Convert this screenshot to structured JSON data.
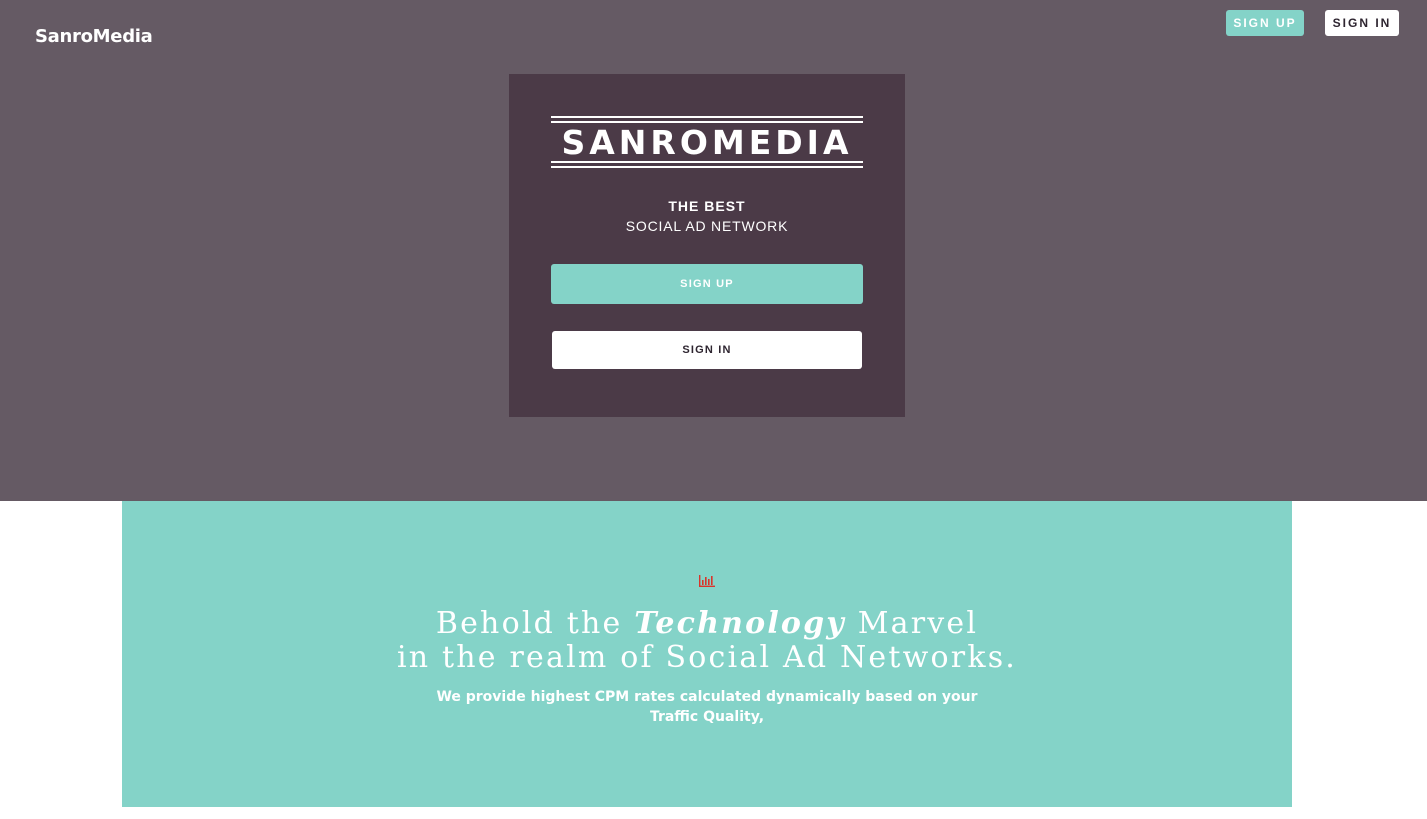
{
  "header": {
    "logo": "SanroMedia",
    "signup_label": "SIGN UP",
    "signin_label": "SIGN IN"
  },
  "panel": {
    "brand": "SANROMEDIA",
    "tagline_line1": "THE BEST",
    "tagline_line2": "SOCIAL AD NETWORK",
    "signup_label": "SIGN UP",
    "signin_label": "SIGN IN"
  },
  "feature": {
    "icon": "bar-chart-icon",
    "headline_prefix": "Behold the",
    "headline_emphasis": "Technology",
    "headline_suffix": "Marvel",
    "headline_line2": "in the realm of Social Ad Networks.",
    "subtext": "We provide highest CPM rates calculated dynamically based on your Traffic Quality,"
  },
  "colors": {
    "hero_bg": "#655a64",
    "panel_bg": "#4b3a47",
    "accent": "#84d3c8",
    "icon": "#d9342b",
    "white": "#ffffff"
  }
}
